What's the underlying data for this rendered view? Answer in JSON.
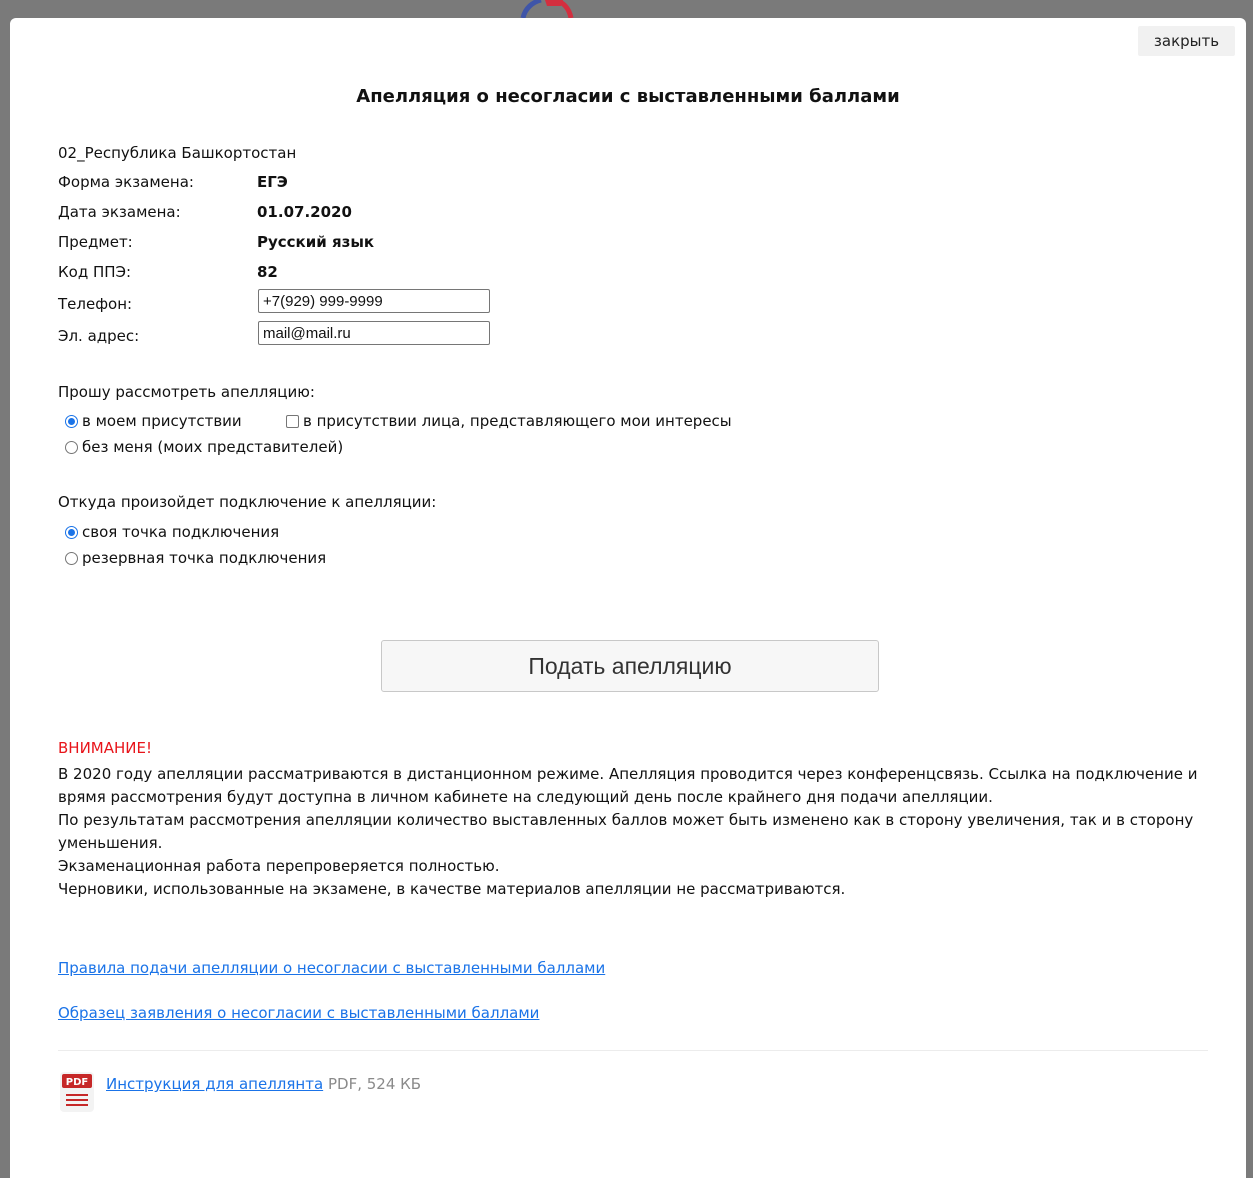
{
  "modal": {
    "close_label": "закрыть",
    "title": "Апелляция о несогласии с выставленными баллами"
  },
  "info": {
    "region": "02_Республика Башкортостан",
    "rows": [
      {
        "label": "Форма экзамена:",
        "value": "ЕГЭ"
      },
      {
        "label": "Дата экзамена:",
        "value": "01.07.2020"
      },
      {
        "label": "Предмет:",
        "value": "Русский язык"
      },
      {
        "label": "Код ППЭ:",
        "value": "82"
      }
    ],
    "phone": {
      "label": "Телефон:",
      "value": "+7(929) 999-9999"
    },
    "email": {
      "label": "Эл. адрес:",
      "value": "mail@mail.ru"
    }
  },
  "presence": {
    "label": "Прошу рассмотреть апелляцию:",
    "options": [
      {
        "label": "в моем присутствии",
        "selected": true
      },
      {
        "label": "в присутствии лица, представляющего мои интересы",
        "checked": false
      },
      {
        "label": "без меня (моих представителей)",
        "selected": false
      }
    ]
  },
  "connection": {
    "label": "Откуда произойдет подключение к апелляции:",
    "options": [
      {
        "label": "своя точка подключения",
        "selected": true
      },
      {
        "label": "резервная точка подключения",
        "selected": false
      }
    ]
  },
  "submit_label": "Подать апелляцию",
  "notice": {
    "title": "ВНИМАНИЕ!",
    "paragraphs": [
      "В 2020 году апелляции рассматриваются в дистанционном режиме. Апелляция проводится через конференцсвязь. Ссылка на подключение и врямя рассмотрения будут доступна в личном кабинете на следующий день после крайнего дня подачи апелляции.",
      "По результатам рассмотрения апелляции количество выставленных баллов может быть изменено как в сторону увеличения, так и в сторону уменьшения.",
      "Экзаменационная работа перепроверяется полностью.",
      "Черновики, использованные на экзамене, в качестве материалов апелляции не рассматриваются."
    ]
  },
  "links": {
    "rules": "Правила подачи апелляции о несогласии с выставленными баллами",
    "sample": "Образец заявления о несогласии с выставленными баллами"
  },
  "attachment": {
    "icon_text": "PDF",
    "link": "Инструкция для апеллянта",
    "meta": "PDF, 524 КБ"
  },
  "colors": {
    "accent": "#1a73e8",
    "warning": "#e8141a",
    "pdf_red": "#c62828"
  }
}
